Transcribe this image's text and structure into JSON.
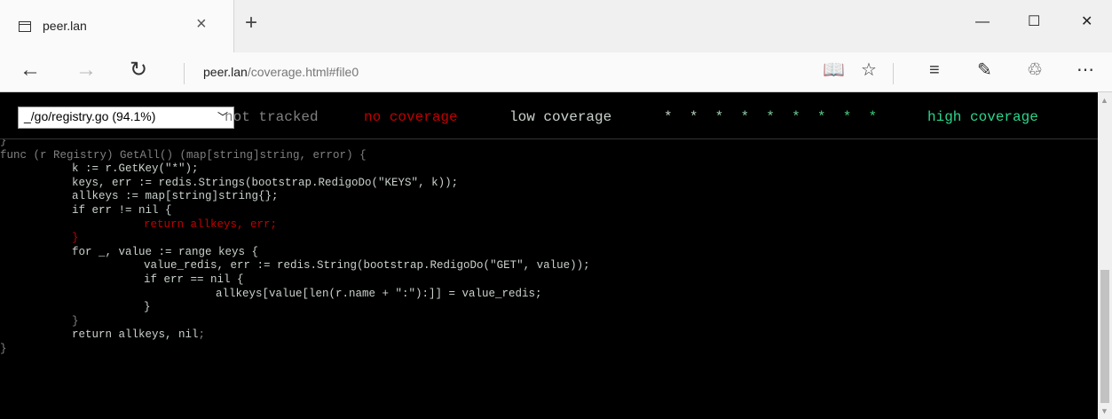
{
  "browser": {
    "tab_title": "peer.lan",
    "tab_close": "×",
    "new_tab": "+",
    "window_controls": {
      "minimize": "—",
      "maximize": "☐",
      "close": "✕"
    },
    "nav": {
      "back": "←",
      "forward": "→",
      "refresh": "↻"
    },
    "address": {
      "host": "peer.lan",
      "path": "/coverage.html#file0"
    },
    "tools": {
      "reading_view": "📖",
      "favorite": "☆",
      "hub": "≡",
      "web_note": "✎",
      "share": "♲",
      "more": "⋯"
    }
  },
  "coverage": {
    "file_select": "_/go/registry.go (94.1%)",
    "legend": {
      "not_tracked": "not tracked",
      "no_coverage": "no coverage",
      "low_coverage": "low coverage",
      "stars": [
        "*",
        "*",
        "*",
        "*",
        "*",
        "*",
        "*",
        "*",
        "*"
      ],
      "high_coverage": "high coverage"
    },
    "colors": {
      "background": "#000000",
      "not_tracked": "#808080",
      "no_coverage": "#c00000",
      "low_coverage": "#cad2cc",
      "high_coverage": "#2cd58b"
    },
    "code_lines": [
      {
        "indent": 0,
        "text": "}",
        "cov": "not_tracked"
      },
      {
        "indent": 0,
        "text": "func (r Registry) GetAll() (map[string]string, error) {",
        "cov": "not_tracked"
      },
      {
        "indent": 1,
        "text": "k := r.GetKey(\"*\");",
        "cov": "low"
      },
      {
        "indent": 1,
        "text": "keys, err := redis.Strings(bootstrap.RedigoDo(\"KEYS\", k));",
        "cov": "low"
      },
      {
        "indent": 1,
        "text": "allkeys := map[string]string{};",
        "cov": "low"
      },
      {
        "indent": 1,
        "text": "if err != nil {",
        "cov": "low"
      },
      {
        "indent": 2,
        "text": "return allkeys, err;",
        "cov": "none"
      },
      {
        "indent": 1,
        "text": "}",
        "cov": "none"
      },
      {
        "indent": 1,
        "text": "for _, value := range keys {",
        "cov": "low"
      },
      {
        "indent": 2,
        "text": "value_redis, err := redis.String(bootstrap.RedigoDo(\"GET\", value));",
        "cov": "low"
      },
      {
        "indent": 2,
        "text": "if err == nil {",
        "cov": "low"
      },
      {
        "indent": 3,
        "text": "allkeys[value[len(r.name + \":\"):]] = value_redis;",
        "cov": "low"
      },
      {
        "indent": 2,
        "text": "}",
        "cov": "low"
      },
      {
        "indent": 1,
        "text": "}",
        "cov": "not_tracked"
      },
      {
        "indent": 1,
        "text": "return allkeys, nil",
        "cov": "low",
        "tail": ";"
      },
      {
        "indent": 0,
        "text": "}",
        "cov": "not_tracked"
      }
    ]
  }
}
